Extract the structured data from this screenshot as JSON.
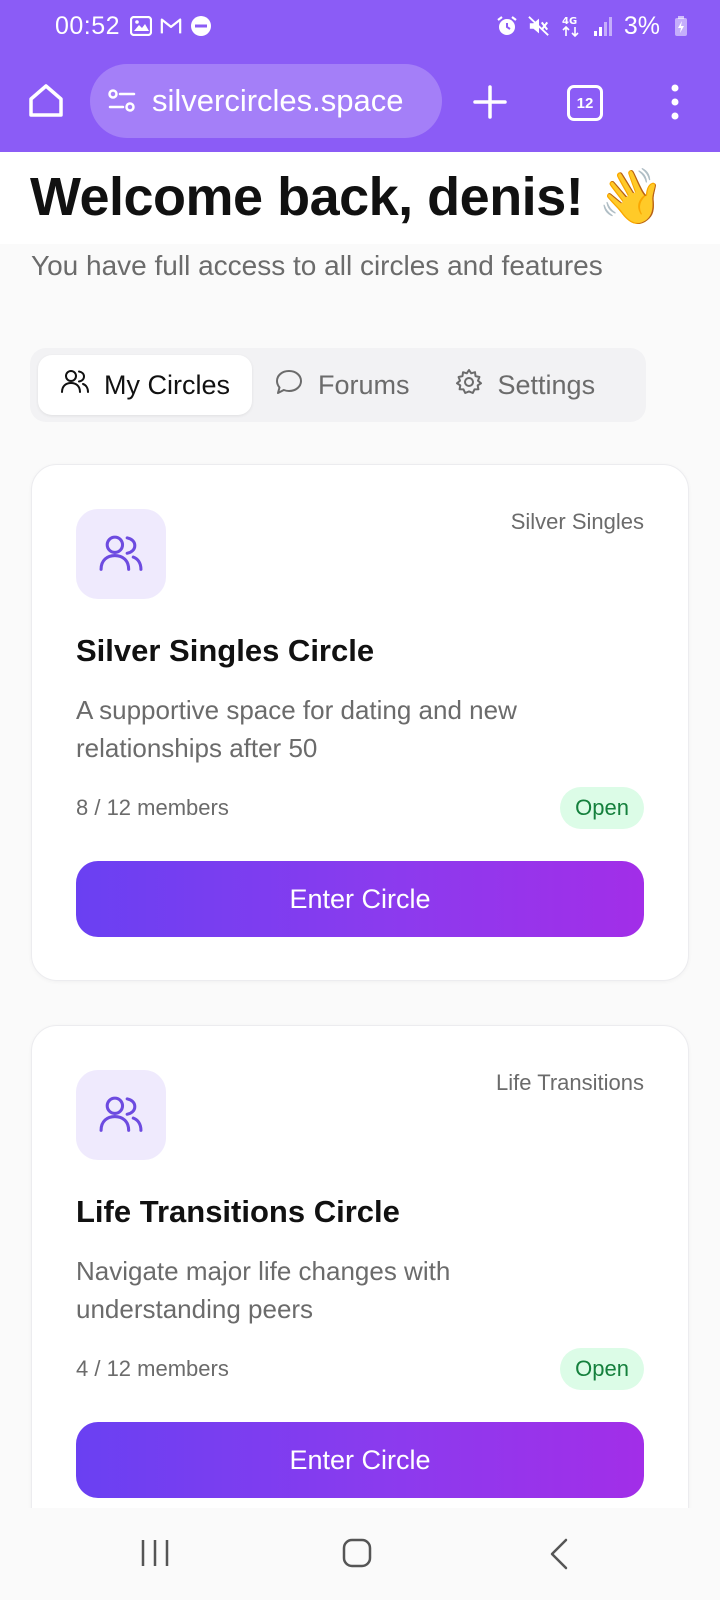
{
  "status_bar": {
    "time": "00:52",
    "battery": "3%",
    "left_icons": [
      "image-icon",
      "gmail-icon",
      "dnd-icon"
    ],
    "right_icons": [
      "alarm-icon",
      "mute-icon",
      "4g-icon",
      "signal-icon",
      "battery-icon"
    ]
  },
  "browser": {
    "url": "silvercircles.space",
    "tab_count": "12"
  },
  "page": {
    "welcome": "Welcome back, denis! 👋",
    "subtitle": "You have full access to all circles and features",
    "tabs": [
      {
        "label": "My Circles",
        "icon": "users-icon",
        "active": true
      },
      {
        "label": "Forums",
        "icon": "chat-bubble-icon",
        "active": false
      },
      {
        "label": "Settings",
        "icon": "gear-icon",
        "active": false
      }
    ],
    "circles": [
      {
        "category": "Silver Singles",
        "title": "Silver Singles Circle",
        "description": "A supportive space for dating and new relationships after 50",
        "members": "8 / 12 members",
        "status": "Open",
        "button": "Enter Circle"
      },
      {
        "category": "Life Transitions",
        "title": "Life Transitions Circle",
        "description": "Navigate major life changes with understanding peers",
        "members": "4 / 12 members",
        "status": "Open",
        "button": "Enter Circle"
      }
    ]
  },
  "colors": {
    "brand": "#8b5cf6",
    "button_gradient_start": "#6a40f2",
    "button_gradient_end": "#a22ee8",
    "open_badge_bg": "#dcfce7",
    "open_badge_text": "#15803d"
  }
}
